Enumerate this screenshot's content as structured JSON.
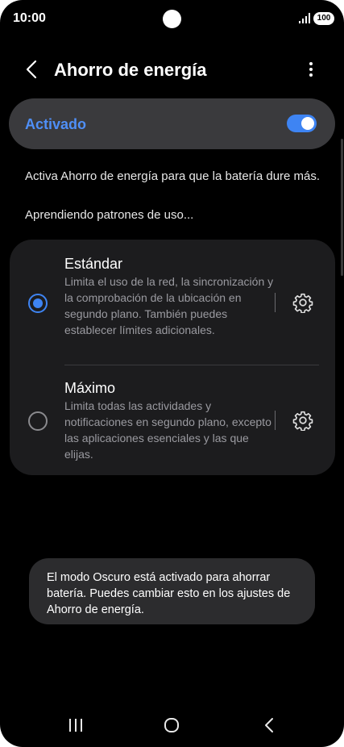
{
  "status_bar": {
    "time": "10:00",
    "battery": "100"
  },
  "app_bar": {
    "title": "Ahorro de energía",
    "back_icon": "chevron-left-icon",
    "more_icon": "more-vert-icon"
  },
  "master_toggle": {
    "label": "Activado",
    "state": "on",
    "accent_color": "#3e84f3"
  },
  "description": "Activa Ahorro de energía para que la batería dure más.",
  "learning_status": "Aprendiendo patrones de uso...",
  "modes": [
    {
      "title": "Estándar",
      "description": "Limita el uso de la red, la sincronización y la comprobación de la ubicación en segundo plano. También puedes establecer límites adicionales.",
      "selected": true
    },
    {
      "title": "Máximo",
      "description": "Limita todas las actividades y notificaciones en segundo plano, excepto las aplicaciones esenciales y las que elijas.",
      "selected": false
    }
  ],
  "toast": "El modo Oscuro está activado para ahorrar batería. Puedes cambiar esto en los ajustes de Ahorro de energía.",
  "nav_bar": {
    "icons": [
      "recent-apps-icon",
      "home-icon",
      "back-icon"
    ]
  }
}
